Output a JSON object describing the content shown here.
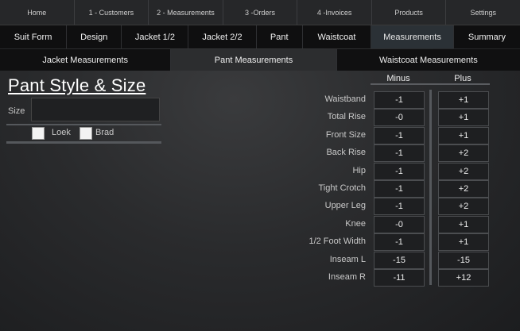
{
  "top_nav": [
    "Home",
    "1 - Customers",
    "2 - Measurements",
    "3 -Orders",
    "4 -Invoices",
    "Products",
    "Settings"
  ],
  "secondary_tabs": [
    "Suit Form",
    "Design",
    "Jacket 1/2",
    "Jacket 2/2",
    "Pant",
    "Waistcoat",
    "Measurements",
    "Summary"
  ],
  "secondary_active": "Measurements",
  "measurement_tabs": [
    "Jacket Measurements",
    "Pant Measurements",
    "Waistcoat Measurements"
  ],
  "measurement_active": "Pant Measurements",
  "pant": {
    "title": "Pant Style & Size",
    "size_label": "Size",
    "size_value": "",
    "options": [
      {
        "label": "Loek",
        "checked": false
      },
      {
        "label": "Brad",
        "checked": false
      }
    ]
  },
  "table": {
    "headers": {
      "minus": "Minus",
      "plus": "Plus"
    },
    "rows": [
      {
        "label": "Waistband",
        "minus": "-1",
        "plus": "+1"
      },
      {
        "label": "Total Rise",
        "minus": "-0",
        "plus": "+1"
      },
      {
        "label": "Front Size",
        "minus": "-1",
        "plus": "+1"
      },
      {
        "label": "Back Rise",
        "minus": "-1",
        "plus": "+2"
      },
      {
        "label": "Hip",
        "minus": "-1",
        "plus": "+2"
      },
      {
        "label": "Tight Crotch",
        "minus": "-1",
        "plus": "+2"
      },
      {
        "label": "Upper Leg",
        "minus": "-1",
        "plus": "+2"
      },
      {
        "label": "Knee",
        "minus": "-0",
        "plus": "+1"
      },
      {
        "label": "1/2 Foot Width",
        "minus": "-1",
        "plus": "+1"
      },
      {
        "label": "Inseam L",
        "minus": "-15",
        "plus": "-15"
      },
      {
        "label": "Inseam R",
        "minus": "-11",
        "plus": "+12"
      }
    ]
  }
}
